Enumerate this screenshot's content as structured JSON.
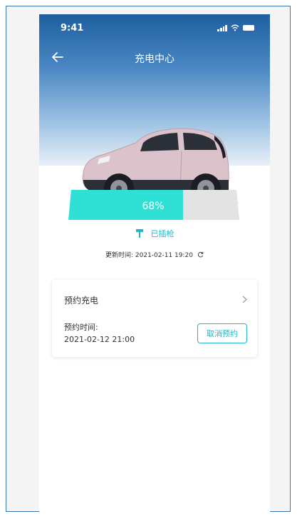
{
  "status_bar": {
    "time": "9:41"
  },
  "nav": {
    "title": "充电中心"
  },
  "battery": {
    "percent_label": "68%",
    "level": 0.68
  },
  "plug": {
    "status": "已插枪"
  },
  "update": {
    "text": "更新时间: 2021-02-11 19:20"
  },
  "reservation": {
    "title": "预约充电",
    "time_label": "预约时间:",
    "time_value": "2021-02-12 21:00",
    "cancel_label": "取消预约"
  },
  "colors": {
    "accent": "#20b8c8",
    "header": "#1e5fa0",
    "bar_fill": "#2fe0d4"
  }
}
